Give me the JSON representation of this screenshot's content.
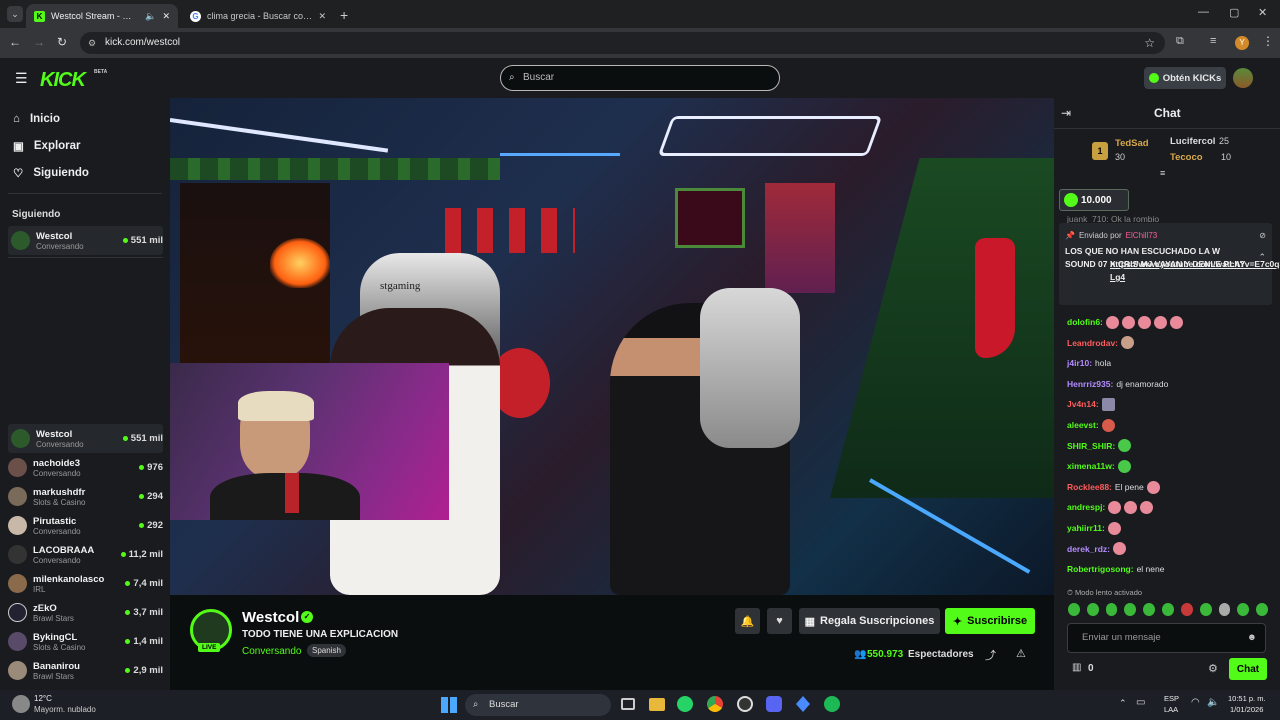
{
  "browser": {
    "tabs": [
      {
        "title": "Westcol Stream - Watch Liv…"
      },
      {
        "title": "clima grecia - Buscar con Goog…"
      }
    ],
    "url": "kick.com/westcol"
  },
  "header": {
    "logo": "KICK",
    "beta": "BETA",
    "search_placeholder": "Buscar",
    "get_kicks": "Obtén KICKs"
  },
  "sidebar": {
    "nav": [
      {
        "label": "Inicio"
      },
      {
        "label": "Explorar"
      },
      {
        "label": "Siguiendo"
      }
    ],
    "following_title": "Siguiendo",
    "following": [
      {
        "name": "Westcol",
        "category": "Conversando",
        "viewers": "551 mil"
      }
    ],
    "channels": [
      {
        "name": "Westcol",
        "category": "Conversando",
        "viewers": "551 mil"
      },
      {
        "name": "nachoide3",
        "category": "Conversando",
        "viewers": "976"
      },
      {
        "name": "markushdfr",
        "category": "Slots & Casino",
        "viewers": "294"
      },
      {
        "name": "Pirutastic",
        "category": "Conversando",
        "viewers": "292"
      },
      {
        "name": "LACOBRAAA",
        "category": "Conversando",
        "viewers": "11,2 mil"
      },
      {
        "name": "milenkanolasco",
        "category": "IRL",
        "viewers": "7,4 mil"
      },
      {
        "name": "zEkO",
        "category": "Brawl Stars",
        "viewers": "3,7 mil"
      },
      {
        "name": "BykingCL",
        "category": "Slots & Casino",
        "viewers": "1,4 mil"
      },
      {
        "name": "Bananirou",
        "category": "Brawl Stars",
        "viewers": "2,9 mil"
      }
    ]
  },
  "stream": {
    "live_badge": "LIVE",
    "streamer": "Westcol",
    "title": "TODO TIENE UNA EXPLICACION",
    "category": "Conversando",
    "language": "Spanish",
    "gift_subs": "Regala Suscripciones",
    "subscribe": "Suscribirse",
    "viewers": "550.973",
    "viewers_label": "Espectadores",
    "chair_brand": "stgaming"
  },
  "chat": {
    "title": "Chat",
    "leaderboard": [
      {
        "rank": "1",
        "name": "TedSad",
        "score": "30"
      },
      {
        "name": "Lucifercol",
        "score": "25"
      },
      {
        "name": "Tecoco",
        "score": "10"
      }
    ],
    "kicks_amount": "10.000",
    "partial_line": "juank_710: Ok la rombio",
    "pinned_by": "Enviado por",
    "pinned_user": "ElChill73",
    "pinned_text": "LOS QUE NO HAN ESCUCHADO LA W SOUND 07 X CRIS MJ VAYAN Y DENLE PLAY",
    "pinned_link": "https://www.youtube.com/watch?v=E7c0q3GGLg4",
    "messages": [
      {
        "user": "dolofin6:",
        "color": "#53fc18",
        "text": "",
        "emotes": 5
      },
      {
        "user": "Leandrodav:",
        "color": "#ff5c5c",
        "text": "",
        "emotes": 1
      },
      {
        "user": "j4ir10:",
        "color": "#b48cff",
        "text": "hola",
        "emotes": 0
      },
      {
        "user": "Henrriz935:",
        "color": "#b48cff",
        "text": "dj enamorado",
        "emotes": 0
      },
      {
        "user": "Jv4n14:",
        "color": "#ff5c5c",
        "text": "",
        "emotes": 1
      },
      {
        "user": "aleevst:",
        "color": "#53fc18",
        "text": "",
        "emotes": 1
      },
      {
        "user": "SHIR_SHIR:",
        "color": "#53fc18",
        "text": "",
        "emotes": 1
      },
      {
        "user": "ximena11w:",
        "color": "#53fc18",
        "text": "",
        "emotes": 1
      },
      {
        "user": "Rocklee88:",
        "color": "#ff5c5c",
        "text": "El pene",
        "emotes": 1
      },
      {
        "user": "andrespj:",
        "color": "#53fc18",
        "text": "",
        "emotes": 3
      },
      {
        "user": "yahiirr11:",
        "color": "#53fc18",
        "text": "",
        "emotes": 1
      },
      {
        "user": "derek_rdz:",
        "color": "#b48cff",
        "text": "",
        "emotes": 1
      },
      {
        "user": "Robertrigosong:",
        "color": "#53fc18",
        "text": "el nene",
        "emotes": 0
      }
    ],
    "slow_mode": "Modo lento activado",
    "input_placeholder": "Enviar un mensaje",
    "kicks_count": "0",
    "send": "Chat"
  },
  "taskbar": {
    "temp": "12°C",
    "weather": "Mayorm. nublado",
    "search": "Buscar",
    "lang1": "ESP",
    "lang2": "LAA",
    "time": "10:51 p. m.",
    "date": "1/01/2026"
  }
}
